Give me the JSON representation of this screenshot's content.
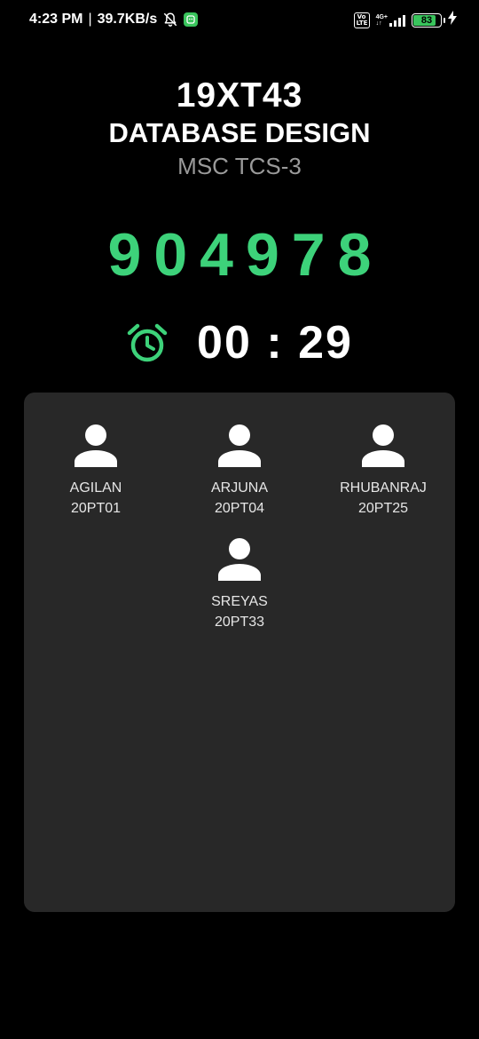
{
  "status_bar": {
    "time": "4:23 PM",
    "separator": "|",
    "network_speed": "39.7KB/s",
    "volte_line1": "Vo",
    "volte_line2": "LTE",
    "network_type": "4G+",
    "battery_level": "83",
    "battery_color": "#39c45c"
  },
  "course": {
    "code": "19XT43",
    "name": "DATABASE DESIGN",
    "class": "MSC TCS-3"
  },
  "session": {
    "code": "904978",
    "code_color": "#3dd27a",
    "timer": "00 : 29",
    "timer_icon": "alarm-clock-icon"
  },
  "members": [
    {
      "name": "AGILAN",
      "id": "20PT01",
      "icon": "person-icon"
    },
    {
      "name": "ARJUNA",
      "id": "20PT04",
      "icon": "person-icon"
    },
    {
      "name": "RHUBANRAJ",
      "id": "20PT25",
      "icon": "person-icon"
    },
    {
      "name": "SREYAS",
      "id": "20PT33",
      "icon": "person-icon"
    }
  ]
}
